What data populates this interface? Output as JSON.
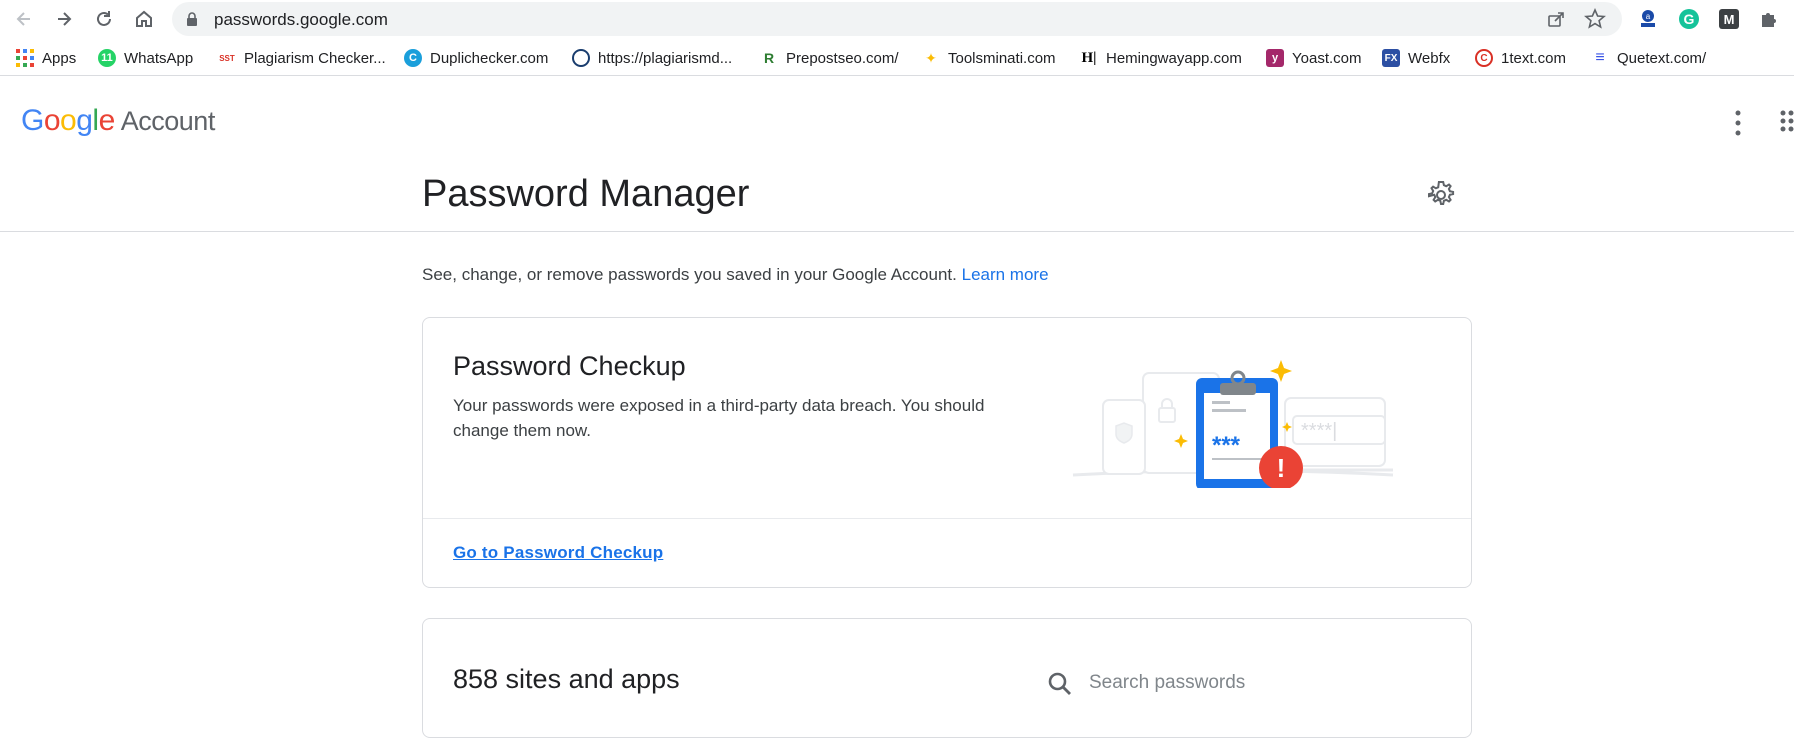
{
  "browser": {
    "url": "passwords.google.com"
  },
  "bookmarks": [
    {
      "label": "Apps",
      "icon": "apps-grid-icon",
      "color": "#ea4335"
    },
    {
      "label": "WhatsApp",
      "icon": "whatsapp-icon",
      "color": "#25d366"
    },
    {
      "label": "Plagiarism Checker...",
      "icon": "sst-icon",
      "color": "#d93025"
    },
    {
      "label": "Duplichecker.com",
      "icon": "duplichecker-icon",
      "color": "#1a9fdb"
    },
    {
      "label": "https://plagiarismd...",
      "icon": "plagiarismdetector-icon",
      "color": "#1a3d6e"
    },
    {
      "label": "Prepostseo.com/",
      "icon": "prepostseo-icon",
      "color": "#2e7d32"
    },
    {
      "label": "Toolsminati.com",
      "icon": "toolsminati-icon",
      "color": "#fbbc04"
    },
    {
      "label": "Hemingwayapp.com",
      "icon": "hemingway-icon",
      "color": "#000000"
    },
    {
      "label": "Yoast.com",
      "icon": "yoast-icon",
      "color": "#a4286a"
    },
    {
      "label": "Webfx",
      "icon": "webfx-icon",
      "color": "#2c4fa3"
    },
    {
      "label": "1text.com",
      "icon": "1text-icon",
      "color": "#d93025"
    },
    {
      "label": "Quetext.com/",
      "icon": "quetext-icon",
      "color": "#3b55e6"
    }
  ],
  "account": {
    "logo_letters": [
      "G",
      "o",
      "o",
      "g",
      "l",
      "e"
    ],
    "logo_colors": [
      "#4285f4",
      "#ea4335",
      "#fbbc05",
      "#4285f4",
      "#34a853",
      "#ea4335"
    ],
    "logo_word": "Account"
  },
  "page": {
    "title": "Password Manager",
    "description": "See, change, or remove passwords you saved in your Google Account.",
    "learn_more": "Learn more"
  },
  "checkup": {
    "title": "Password Checkup",
    "text": "Your passwords were exposed in a third-party data breach. You should change them now.",
    "link": "Go to Password Checkup",
    "illustration_stars": "***",
    "illustration_masked": "****|",
    "illustration_alert": "!"
  },
  "saved": {
    "title": "858 sites and apps",
    "search_placeholder": "Search passwords"
  },
  "colors": {
    "link": "#1a73e8",
    "alert": "#ea4335",
    "clipboard": "#1a73e8"
  }
}
